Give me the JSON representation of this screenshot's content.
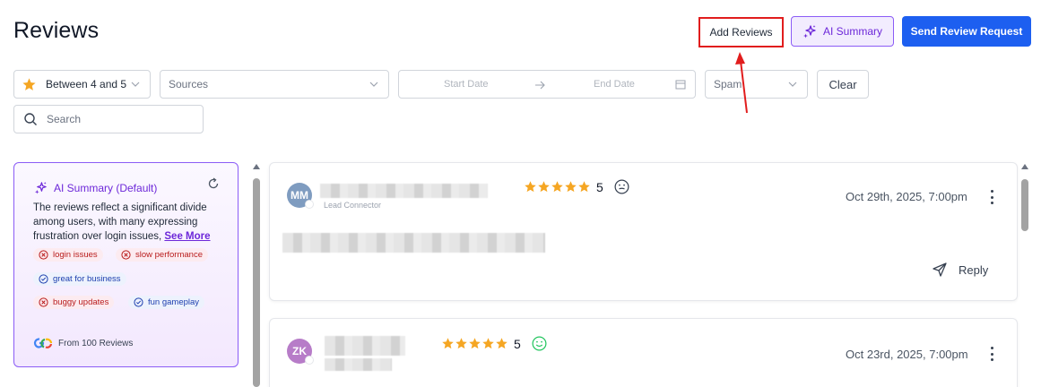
{
  "page": {
    "title": "Reviews"
  },
  "header_buttons": {
    "add_reviews": "Add Reviews",
    "ai_summary": "AI Summary",
    "send_request": "Send Review Request"
  },
  "filters": {
    "rating": "Between 4 and 5",
    "sources_placeholder": "Sources",
    "start_date_placeholder": "Start Date",
    "end_date_placeholder": "End Date",
    "spam": "Spam",
    "clear": "Clear",
    "search_placeholder": "Search"
  },
  "ai_summary_card": {
    "title": "AI Summary (Default)",
    "summary": "The reviews reflect a significant divide among users, with many expressing frustration over login issues,",
    "see_more": "See More",
    "tags": [
      {
        "label": "login issues",
        "sentiment": "negative"
      },
      {
        "label": "slow performance",
        "sentiment": "negative"
      },
      {
        "label": "great for business",
        "sentiment": "positive"
      },
      {
        "label": "buggy updates",
        "sentiment": "negative"
      },
      {
        "label": "fun gameplay",
        "sentiment": "positive"
      }
    ],
    "footer": "From 100 Reviews"
  },
  "reviews": [
    {
      "initials": "MM",
      "avatar_color": "#7f9cc0",
      "rating": 5,
      "sentiment": "neutral",
      "date": "Oct 29th, 2025, 7:00pm",
      "sub_label": "Lead Connector",
      "reply_label": "Reply"
    },
    {
      "initials": "ZK",
      "avatar_color": "#b77cc8",
      "rating": 5,
      "sentiment": "positive",
      "date": "Oct 23rd, 2025, 7:00pm"
    }
  ],
  "colors": {
    "primary": "#1d5ff0",
    "ai_purple": "#6d28d9",
    "star": "#f5a623",
    "highlight_red": "#e11d1d"
  }
}
